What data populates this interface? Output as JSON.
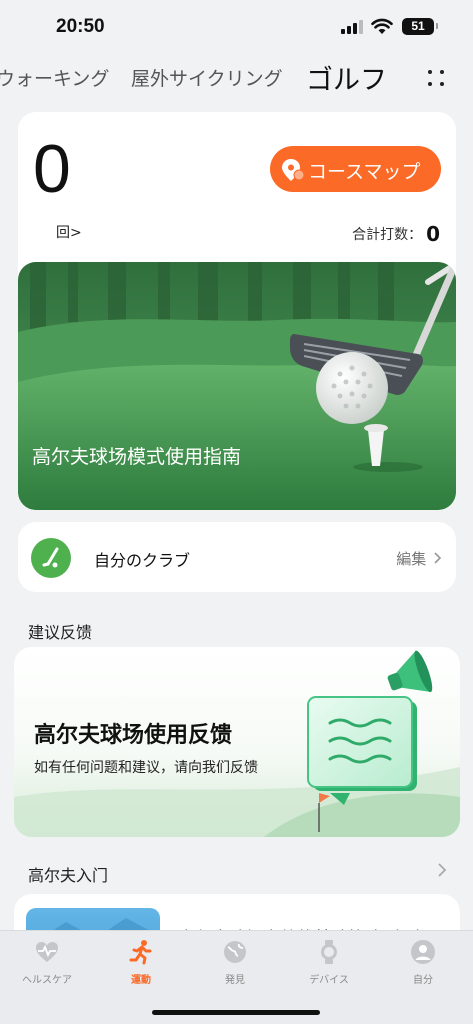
{
  "status_bar": {
    "time": "20:50",
    "battery": "51"
  },
  "tabs": {
    "walking": "ウォーキング",
    "cycling": "屋外サイクリング",
    "golf": "ゴルフ"
  },
  "summary": {
    "count": "0",
    "count_unit": "回>",
    "course_map_label": "コースマップ",
    "total_strokes_label": "合計打数：",
    "total_strokes_value": "0"
  },
  "banner": {
    "title": "高尔夫球场模式使用指南"
  },
  "clubs": {
    "label": "自分のクラブ",
    "edit": "編集"
  },
  "feedback_section": {
    "title": "建议反馈",
    "card_title": "高尔夫球场使用反馈",
    "card_desc": "如有任何问题和建议，请向我们反馈"
  },
  "intro_section": {
    "title": "高尔夫入门",
    "article_title": "高尔夫球场实战的基础策略（下）"
  },
  "bottom_nav": [
    {
      "label": "ヘルスケア",
      "icon": "heart-pulse-icon",
      "active": false
    },
    {
      "label": "運動",
      "icon": "running-icon",
      "active": true
    },
    {
      "label": "発見",
      "icon": "globe-icon",
      "active": false
    },
    {
      "label": "デバイス",
      "icon": "watch-icon",
      "active": false
    },
    {
      "label": "自分",
      "icon": "person-icon",
      "active": false
    }
  ],
  "colors": {
    "accent": "#fb6a26",
    "club_green": "#4fb04e",
    "banner_green": "#3f8f4c"
  }
}
